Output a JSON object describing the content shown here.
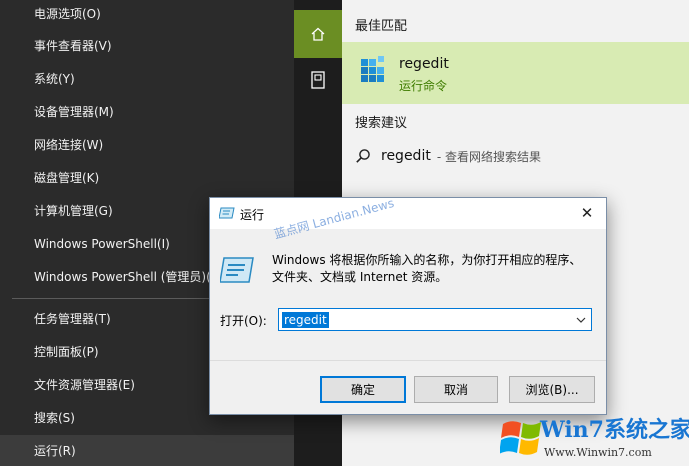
{
  "winx_menu": {
    "items": [
      {
        "label": "电源选项(O)"
      },
      {
        "label": "事件查看器(V)"
      },
      {
        "label": "系统(Y)"
      },
      {
        "label": "设备管理器(M)"
      },
      {
        "label": "网络连接(W)"
      },
      {
        "label": "磁盘管理(K)"
      },
      {
        "label": "计算机管理(G)"
      },
      {
        "label": "Windows PowerShell(I)"
      },
      {
        "label": "Windows PowerShell (管理员)(A)"
      },
      {
        "label": "任务管理器(T)"
      },
      {
        "label": "控制面板(P)"
      },
      {
        "label": "文件资源管理器(E)"
      },
      {
        "label": "搜索(S)"
      },
      {
        "label": "运行(R)"
      }
    ]
  },
  "start_rail": {
    "accent_color": "#6b8e23",
    "icons": [
      "home-icon",
      "document-icon"
    ]
  },
  "search_results": {
    "best_match_header": "最佳匹配",
    "best_match": {
      "title": "regedit",
      "subtitle": "运行命令",
      "icon": "regedit-icon"
    },
    "suggestions_header": "搜索建议",
    "web_suggestion": {
      "query": "regedit",
      "subtitle": "- 查看网络搜索结果",
      "icon": "search-icon"
    }
  },
  "run_dialog": {
    "title": "运行",
    "watermark": "蓝点网 Landian.News",
    "description": "Windows 将根据你所输入的名称，为你打开相应的程序、文件夹、文档或 Internet 资源。",
    "open_label": "打开(O):",
    "open_value": "regedit",
    "ok_label": "确定",
    "cancel_label": "取消",
    "browse_label": "浏览(B)..."
  },
  "site_logo": {
    "text_main": "Win7系统之家",
    "text_url": "Www.Winwin7.com",
    "brand_blue": "#1976d2",
    "brand_orange": "#e87a00"
  }
}
